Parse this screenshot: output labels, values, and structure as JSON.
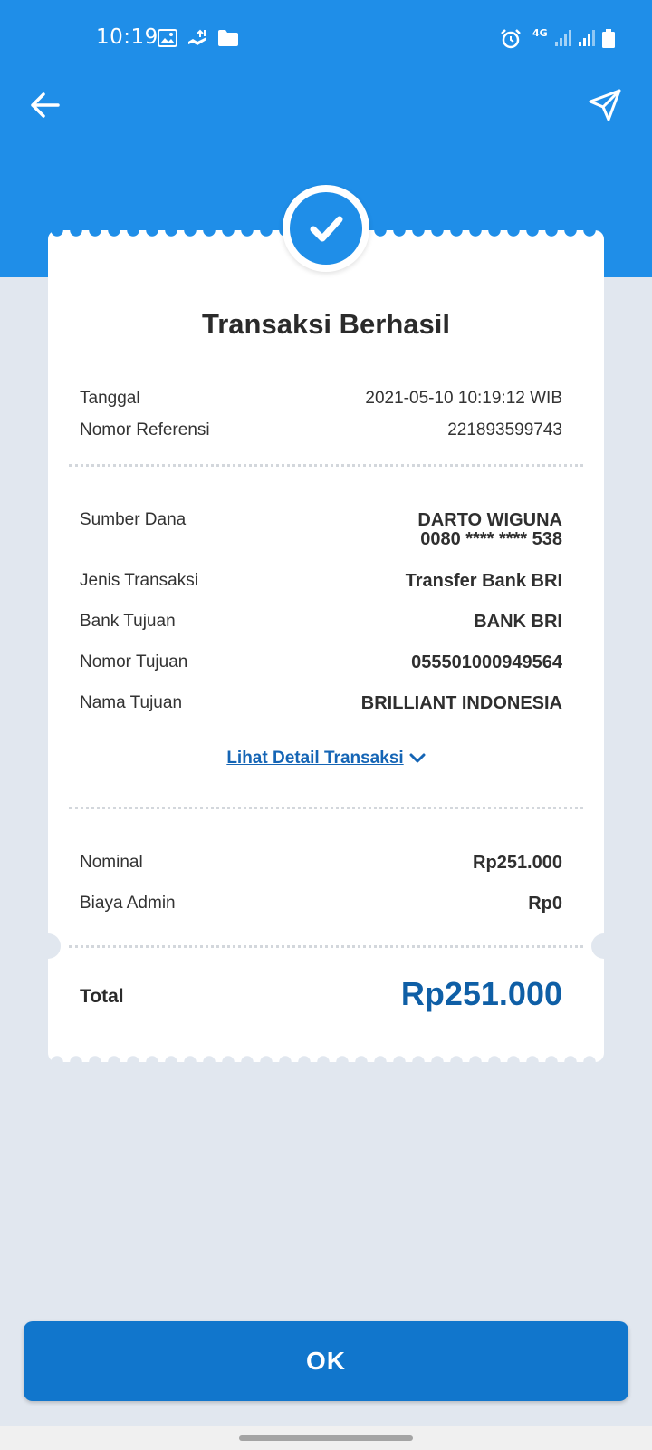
{
  "status_bar": {
    "time": "10:19",
    "network": "4G",
    "icons": [
      "image-icon",
      "data-transfer-icon",
      "folder-icon",
      "alarm-icon",
      "signal-icon",
      "battery-icon"
    ]
  },
  "app_bar": {
    "back_icon": "arrow-left-icon",
    "share_icon": "send-icon"
  },
  "receipt": {
    "status_icon": "check-icon",
    "title": "Transaksi Berhasil",
    "summary": [
      {
        "label": "Tanggal",
        "value": "2021-05-10 10:19:12 WIB"
      },
      {
        "label": "Nomor Referensi",
        "value": "221893599743"
      }
    ],
    "details": [
      {
        "label": "Sumber Dana",
        "value": "DARTO WIGUNA",
        "value2": "0080 **** **** 538"
      },
      {
        "label": "Jenis Transaksi",
        "value": "Transfer Bank BRI"
      },
      {
        "label": "Bank Tujuan",
        "value": "BANK BRI"
      },
      {
        "label": "Nomor Tujuan",
        "value": "055501000949564"
      },
      {
        "label": "Nama Tujuan",
        "value": "BRILLIANT INDONESIA"
      }
    ],
    "detail_link": "Lihat Detail Transaksi",
    "amounts": [
      {
        "label": "Nominal",
        "value": "Rp251.000"
      },
      {
        "label": "Biaya Admin",
        "value": "Rp0"
      }
    ],
    "total_label": "Total",
    "total_value": "Rp251.000"
  },
  "ok_button": {
    "label": "OK"
  },
  "colors": {
    "primary": "#1f8ee8",
    "button": "#1176cc",
    "total_text": "#0f5fa6",
    "link": "#1565b5",
    "background": "#e1e7ef"
  }
}
